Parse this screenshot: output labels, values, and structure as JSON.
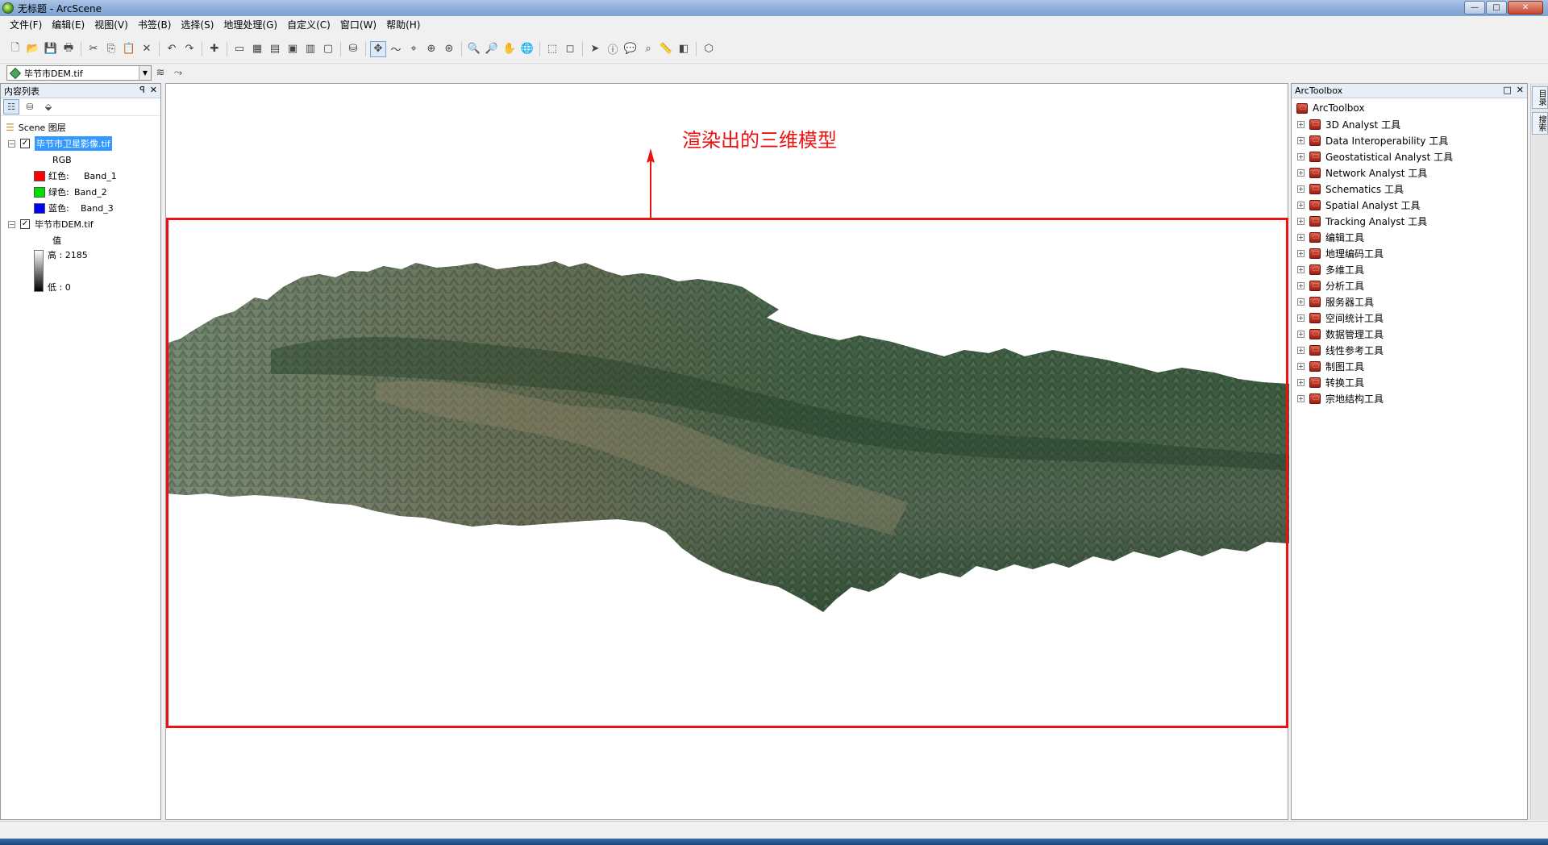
{
  "window": {
    "title": "无标题 - ArcScene",
    "controls": {
      "minimize": "—",
      "maximize": "□",
      "close": "✕"
    }
  },
  "menu": [
    "文件(F)",
    "编辑(E)",
    "视图(V)",
    "书签(B)",
    "选择(S)",
    "地理处理(G)",
    "自定义(C)",
    "窗口(W)",
    "帮助(H)"
  ],
  "toolbar": {
    "icons": [
      {
        "name": "new-icon",
        "glyph": "🗋"
      },
      {
        "name": "open-icon",
        "glyph": "📂"
      },
      {
        "name": "save-icon",
        "glyph": "💾"
      },
      {
        "name": "print-icon",
        "glyph": "🖶"
      },
      {
        "sep": true
      },
      {
        "name": "cut-icon",
        "glyph": "✂"
      },
      {
        "name": "copy-icon",
        "glyph": "⎘"
      },
      {
        "name": "paste-icon",
        "glyph": "📋"
      },
      {
        "name": "delete-icon",
        "glyph": "✕"
      },
      {
        "sep": true
      },
      {
        "name": "undo-icon",
        "glyph": "↶"
      },
      {
        "name": "redo-icon",
        "glyph": "↷"
      },
      {
        "sep": true
      },
      {
        "name": "add-data-icon",
        "glyph": "✚"
      },
      {
        "sep": true
      },
      {
        "name": "scene-properties-icon",
        "glyph": "▭"
      },
      {
        "name": "toc-window-icon",
        "glyph": "▦"
      },
      {
        "name": "catalog-icon",
        "glyph": "▤"
      },
      {
        "name": "python-icon",
        "glyph": "▣"
      },
      {
        "name": "toolbox-icon",
        "glyph": "▥"
      },
      {
        "name": "command-line-icon",
        "glyph": "▢"
      },
      {
        "sep": true
      },
      {
        "name": "model-builder-icon",
        "glyph": "⛁"
      },
      {
        "sep": true
      },
      {
        "name": "navigate-icon",
        "glyph": "✥",
        "active": true
      },
      {
        "name": "fly-icon",
        "glyph": "〜"
      },
      {
        "name": "center-target-icon",
        "glyph": "⌖"
      },
      {
        "name": "zoom-target-icon",
        "glyph": "⊕"
      },
      {
        "name": "set-observer-icon",
        "glyph": "⊛"
      },
      {
        "sep": true
      },
      {
        "name": "zoom-in-icon",
        "glyph": "🔍"
      },
      {
        "name": "zoom-out-icon",
        "glyph": "🔎"
      },
      {
        "name": "pan-icon",
        "glyph": "✋"
      },
      {
        "name": "full-extent-icon",
        "glyph": "🌐"
      },
      {
        "sep": true
      },
      {
        "name": "select-features-icon",
        "glyph": "⬚"
      },
      {
        "name": "clear-selection-icon",
        "glyph": "◻"
      },
      {
        "sep": true
      },
      {
        "name": "select-elements-icon",
        "glyph": "➤"
      },
      {
        "name": "identify-icon",
        "glyph": "ⓘ"
      },
      {
        "name": "html-popup-icon",
        "glyph": "💬"
      },
      {
        "name": "find-icon",
        "glyph": "⌕"
      },
      {
        "name": "measure-icon",
        "glyph": "📏"
      },
      {
        "name": "swipe-icon",
        "glyph": "◧"
      },
      {
        "sep": true
      },
      {
        "name": "3d-effects-icon",
        "glyph": "⬡"
      }
    ],
    "layer_dropdown": "毕节市DEM.tif"
  },
  "toc": {
    "title": "内容列表",
    "pin": "ꟼ",
    "close": "✕",
    "root_label": "Scene 图层",
    "layers": [
      {
        "name": "毕节市卫星影像.tif",
        "checked": true,
        "selected": true,
        "renderer": "RGB",
        "bands": [
          {
            "channel": "红色:",
            "band": "Band_1",
            "color": "#ff0000"
          },
          {
            "channel": "绿色:",
            "band": "Band_2",
            "color": "#00e000"
          },
          {
            "channel": "蓝色:",
            "band": "Band_3",
            "color": "#0000ff"
          }
        ]
      },
      {
        "name": "毕节市DEM.tif",
        "checked": true,
        "selected": false,
        "renderer": "值",
        "high": "高 : 2185",
        "low": "低 : 0"
      }
    ]
  },
  "scene": {
    "annotation": "渲染出的三维模型",
    "annotation_color": "#e11111"
  },
  "arctoolbox": {
    "title": "ArcToolbox",
    "root": "ArcToolbox",
    "items": [
      "3D Analyst 工具",
      "Data Interoperability 工具",
      "Geostatistical Analyst 工具",
      "Network Analyst 工具",
      "Schematics 工具",
      "Spatial Analyst 工具",
      "Tracking Analyst 工具",
      "编辑工具",
      "地理编码工具",
      "多维工具",
      "分析工具",
      "服务器工具",
      "空间统计工具",
      "数据管理工具",
      "线性参考工具",
      "制图工具",
      "转换工具",
      "宗地结构工具"
    ]
  },
  "dock_tabs": [
    "目录",
    "搜索"
  ]
}
